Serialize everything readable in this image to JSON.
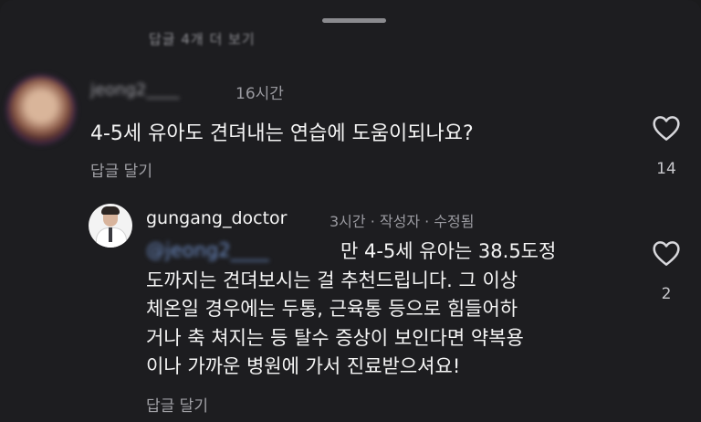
{
  "thread": {
    "view_replies": "답글 4개 더 보기"
  },
  "comment": {
    "username": "jeong2____",
    "time": "16시간",
    "text": "4-5세 유아도 견뎌내는 연습에 도움이되나요?",
    "reply_label": "답글 달기",
    "like_count": "14",
    "like_icon": "heart-outline-icon"
  },
  "reply": {
    "username": "gungang_doctor",
    "meta": "3시간 · 작성자 · 수정됨",
    "mention": "@jeong2____",
    "lines": [
      "만 4-5세 유아는 38.5도정",
      "도까지는 견뎌보시는 걸 추천드립니다. 그 이상",
      "체온일 경우에는 두통, 근육통 등으로 힘들어하",
      "거나 축 쳐지는 등 탈수 증상이 보인다면 약복용",
      "이나 가까운 병원에 가서 진료받으셔요!"
    ],
    "reply_label": "답글 달기",
    "like_count": "2",
    "like_icon": "heart-outline-icon"
  }
}
